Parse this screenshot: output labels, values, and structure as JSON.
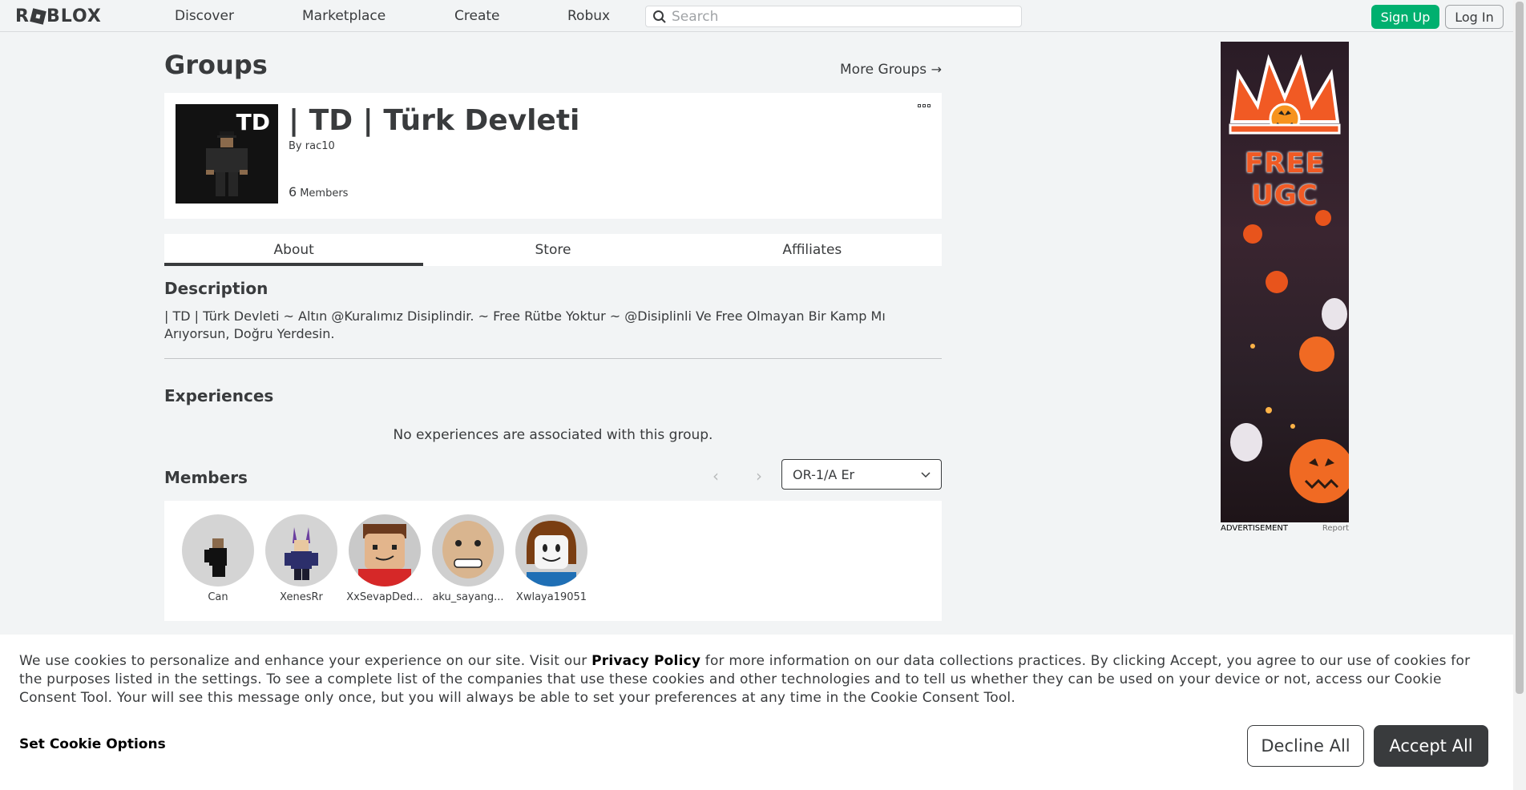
{
  "nav": {
    "logo_left": "R",
    "logo_right": "BLOX",
    "links": [
      "Discover",
      "Marketplace",
      "Create",
      "Robux"
    ],
    "search_placeholder": "Search",
    "signup_label": "Sign Up",
    "login_label": "Log In"
  },
  "page": {
    "title": "Groups",
    "more_groups": "More Groups",
    "more_groups_arrow": "→"
  },
  "group": {
    "emblem_text": "TD",
    "name": "| TD | Türk Devleti",
    "by_prefix": "By",
    "owner": "rac10",
    "member_count": "6",
    "member_label": "Members"
  },
  "tabs": [
    "About",
    "Store",
    "Affiliates"
  ],
  "about": {
    "description_title": "Description",
    "description": "| TD | Türk Devleti ~ Altın @Kuralımız Disiplindir. ~ Free Rütbe Yoktur ~ @Disiplinli Ve Free Olmayan Bir Kamp Mı Arıyorsun, Doğru Yerdesin.",
    "experiences_title": "Experiences",
    "no_experiences": "No experiences are associated with this group.",
    "members_title": "Members",
    "role_selected": "OR-1/A Er",
    "pager_prev": "‹",
    "pager_next": "›"
  },
  "members": [
    {
      "name": "Can"
    },
    {
      "name": "XenesRr"
    },
    {
      "name": "XxSevapDed..."
    },
    {
      "name": "aku_sayang..."
    },
    {
      "name": "Xwlaya19051"
    }
  ],
  "ad": {
    "headline": "FREE UGC",
    "label": "ADVERTISEMENT",
    "report": "Report"
  },
  "cookie": {
    "text_before": "We use cookies to personalize and enhance your experience on our site. Visit our ",
    "privacy_link": "Privacy Policy",
    "text_after": " for more information on our data collections practices. By clicking Accept, you agree to our use of cookies for the purposes listed in the settings. To see a complete list of the companies that use these cookies and other technologies and to tell us whether they can be used on your device or not, access our Cookie Consent Tool. Your will see this message only once, but you will always be able to set your preferences at any time in the Cookie Consent Tool.",
    "set_options": "Set Cookie Options",
    "decline": "Decline All",
    "accept": "Accept All"
  },
  "colors": {
    "signup_green": "#00b06f",
    "text_dark": "#393b3d",
    "background": "#f2f4f5"
  }
}
